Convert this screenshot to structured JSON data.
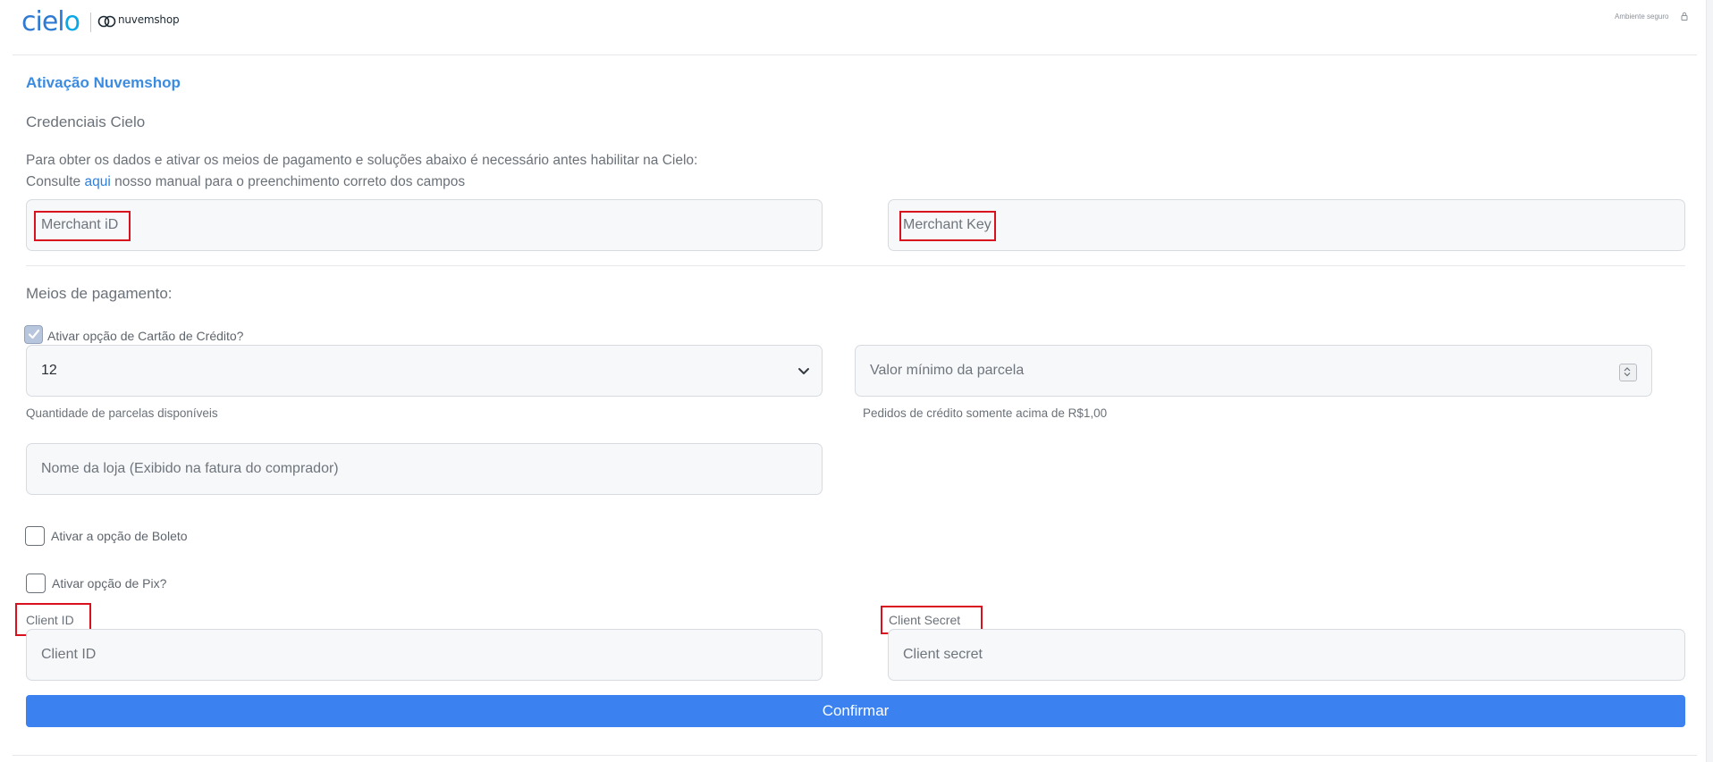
{
  "header": {
    "logo_prefix": "ciel",
    "logo_suffix": "o",
    "partner_name": "nuvemshop",
    "secure_label": "Ambiente seguro"
  },
  "page": {
    "title": "Ativação Nuvemshop"
  },
  "credentials": {
    "title": "Credenciais Cielo",
    "description": "Para obter os dados e ativar os meios de pagamento e soluções abaixo é necessário antes habilitar na Cielo:",
    "manual_prefix": "Consulte ",
    "manual_link": "aqui",
    "manual_suffix": " nosso manual para o preenchimento correto dos campos",
    "merchant_id_placeholder": "Merchant iD",
    "merchant_key_placeholder": "Merchant Key"
  },
  "payment_methods": {
    "title": "Meios de pagamento:",
    "credit_card_label": "Ativar opção de Cartão de Crédito?",
    "credit_card_checked": true,
    "installments_value": "12",
    "installments_help": "Quantidade de parcelas disponíveis",
    "min_installment_placeholder": "Valor mínimo da parcela",
    "min_installment_help": "Pedidos de crédito somente acima de R$1,00",
    "store_name_placeholder": "Nome da loja (Exibido na fatura do comprador)",
    "boleto_label": "Ativar a opção de Boleto",
    "boleto_checked": false,
    "pix_label": "Ativar opção de Pix?",
    "pix_checked": false,
    "client_id_label": "Client ID",
    "client_id_placeholder": "Client ID",
    "client_secret_label": "Client Secret",
    "client_secret_placeholder": "Client secret"
  },
  "actions": {
    "confirm_label": "Confirmar"
  },
  "colors": {
    "accent": "#3b82f0",
    "title": "#3b8be0",
    "annotation": "#d9101e"
  }
}
